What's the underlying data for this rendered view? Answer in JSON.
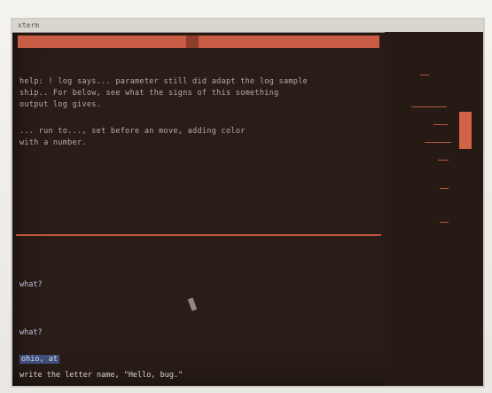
{
  "window": {
    "title": "xterm"
  },
  "terminal": {
    "lines": [
      "help: ! log says... parameter still did adapt the log sample",
      "ship.. For below, see what the signs of this something",
      "output log gives.",
      "... run to..., set before an move, adding color",
      "with a number."
    ],
    "prompt1": "what?",
    "prompt2": "what?",
    "highlight": "ohio, at",
    "final_line": "write the letter name, \"Hello, bug.\""
  },
  "colors": {
    "background": "#2a1d18",
    "accent": "#c95c45",
    "text": "#bda9a0",
    "prompt": "#b9c3d6"
  }
}
